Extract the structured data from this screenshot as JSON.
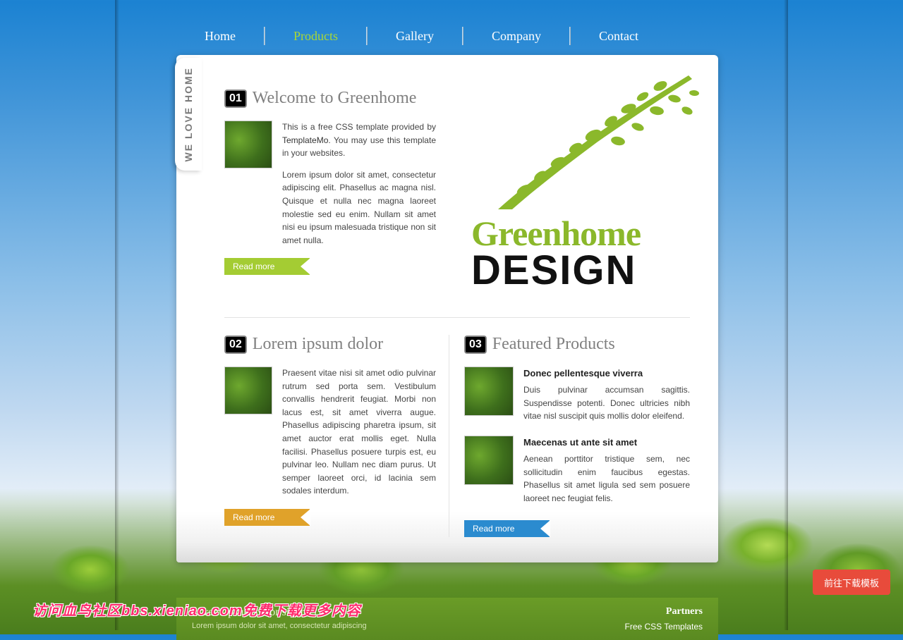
{
  "nav": {
    "items": [
      "Home",
      "Products",
      "Gallery",
      "Company",
      "Contact"
    ],
    "active_index": 1
  },
  "side_tab": "WE LOVE HOME",
  "hero": {
    "word1": "Greenhome",
    "word2": "DESIGN"
  },
  "sections": {
    "welcome": {
      "num": "01",
      "title": "Welcome to Greenhome",
      "p1_a": "This is a free CSS template provided by ",
      "p1_link": "TemplateMo",
      "p1_b": ". You may use this template in your websites.",
      "p2": "Lorem ipsum dolor sit amet, consectetur adipiscing elit. Phasellus ac magna nisl. Quisque et nulla nec magna laoreet molestie sed eu enim. Nullam sit amet nisi eu ipsum malesuada tristique non sit amet nulla.",
      "button": "Read more"
    },
    "lorem": {
      "num": "02",
      "title": "Lorem ipsum dolor",
      "p1": "Praesent vitae nisi sit amet odio pulvinar rutrum sed porta sem. Vestibulum convallis hendrerit feugiat. Morbi non lacus est, sit amet viverra augue. Phasellus adipiscing pharetra ipsum, sit amet auctor erat mollis eget. Nulla facilisi. Phasellus posuere turpis est, eu pulvinar leo. Nullam nec diam purus. Ut semper laoreet orci, id lacinia sem sodales interdum.",
      "button": "Read more"
    },
    "featured": {
      "num": "03",
      "title": "Featured Products",
      "products": [
        {
          "name": "Donec pellentesque viverra",
          "desc": "Duis pulvinar accumsan sagittis. Suspendisse potenti. Donec ultricies nibh vitae nisl suscipit quis mollis dolor eleifend."
        },
        {
          "name": "Maecenas ut ante sit amet",
          "desc": "Aenean porttitor tristique sem, nec sollicitudin enim faucibus egestas. Phasellus sit amet ligula sed sem posuere laoreet nec feugiat felis."
        }
      ],
      "button": "Read more"
    }
  },
  "footer": {
    "left_title": "Lorem ipsum dolor sit amet",
    "left_sub": "Lorem ipsum dolor sit amet, consectetur adipiscing",
    "right_title": "Partners",
    "right_link": "Free CSS Templates"
  },
  "cta": "前往下载模板",
  "watermark": "访问血鸟社区bbs.xieniao.com免费下载更多内容"
}
